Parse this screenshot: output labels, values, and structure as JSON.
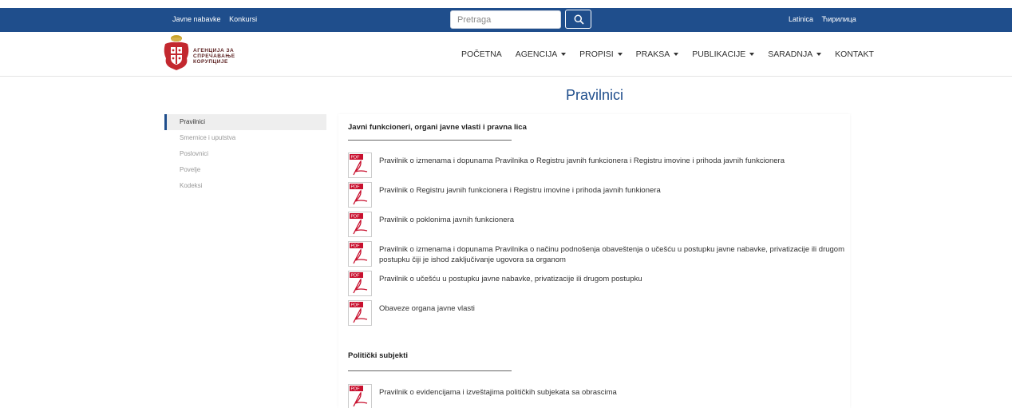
{
  "topbar": {
    "links": [
      "Javne nabavke",
      "Konkursi"
    ],
    "search_placeholder": "Pretraga",
    "languages": [
      "Latinica",
      "Ћирилица"
    ]
  },
  "logo": {
    "lines": [
      "АГЕНЦИЈА ЗА",
      "СПРЕЧАВАЊЕ",
      "КОРУПЦИЈЕ"
    ]
  },
  "nav": {
    "items": [
      {
        "label": "POČETNA",
        "dropdown": false
      },
      {
        "label": "AGENCIJA",
        "dropdown": true
      },
      {
        "label": "PROPISI",
        "dropdown": true
      },
      {
        "label": "PRAKSA",
        "dropdown": true
      },
      {
        "label": "PUBLIKACIJE",
        "dropdown": true
      },
      {
        "label": "SARADNJA",
        "dropdown": true
      },
      {
        "label": "KONTAKT",
        "dropdown": false
      }
    ]
  },
  "page": {
    "title": "Pravilnici"
  },
  "sidebar": {
    "items": [
      {
        "label": "Pravilnici",
        "active": true
      },
      {
        "label": "Smernice i uputstva",
        "active": false
      },
      {
        "label": "Poslovnici",
        "active": false
      },
      {
        "label": "Povelje",
        "active": false
      },
      {
        "label": "Kodeksi",
        "active": false
      }
    ]
  },
  "sections": [
    {
      "title": "Javni funkcioneri, organi javne vlasti i pravna lica",
      "documents": [
        "Pravilnik o izmenama i dopunama Pravilnika o Registru javnih funkcionera i Registru imovine i prihoda javnih funkcionera",
        "Pravilnik o Registru javnih funkcionera i Registru imovine i prihoda javnih funkionera",
        "Pravilnik o poklonima javnih funkcionera",
        "Pravilnik o izmenama i dopunama Pravilnika o načinu podnošenja obaveštenja o učešću u postupku javne nabavke, privatizacije ili drugom postupku čiji je ishod zaključivanje ugovora sa organom",
        "Pravilnik o učešću u postupku javne nabavke, privatizacije ili drugom postupku",
        "Obaveze organa javne vlasti"
      ]
    },
    {
      "title": "Politički subjekti",
      "documents": [
        "Pravilnik o evidencijama i izveštajima političkih subjekata sa obrascima"
      ]
    }
  ],
  "pdf_badge": "PDF",
  "colors": {
    "brand_blue": "#1f4e8c",
    "pdf_red": "#c8102e"
  }
}
